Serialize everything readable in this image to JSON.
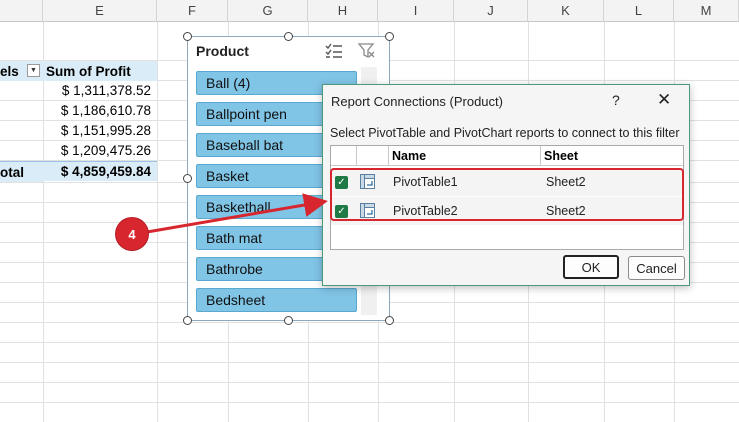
{
  "columns": [
    "E",
    "F",
    "G",
    "H",
    "I",
    "J",
    "K",
    "L",
    "M"
  ],
  "pivot": {
    "col_a_header": "els",
    "col_b_header": "Sum of Profit",
    "values": [
      "$ 1,311,378.52",
      "$ 1,186,610.78",
      "$ 1,151,995.28",
      "$ 1,209,475.26"
    ],
    "total_label": "otal",
    "total_value": "$ 4,859,459.84"
  },
  "slicer": {
    "title": "Product",
    "items": [
      "Ball (4)",
      "Ballpoint pen",
      "Baseball bat",
      "Basket",
      "Baskethall",
      "Bath mat",
      "Bathrobe",
      "Bedsheet"
    ]
  },
  "dialog": {
    "title": "Report Connections (Product)",
    "help": "?",
    "close": "✕",
    "instruction": "Select PivotTable and PivotChart reports to connect to this filter",
    "headers": {
      "name": "Name",
      "sheet": "Sheet"
    },
    "rows": [
      {
        "name": "PivotTable1",
        "sheet": "Sheet2",
        "checked": true
      },
      {
        "name": "PivotTable2",
        "sheet": "Sheet2",
        "checked": true
      }
    ],
    "ok_label": "OK",
    "cancel_label": "Cancel"
  },
  "annotation": {
    "step": "4"
  },
  "colors": {
    "accent_red": "#d7262e",
    "slicer_item": "#80c4e6",
    "check_green": "#1f7a45"
  }
}
